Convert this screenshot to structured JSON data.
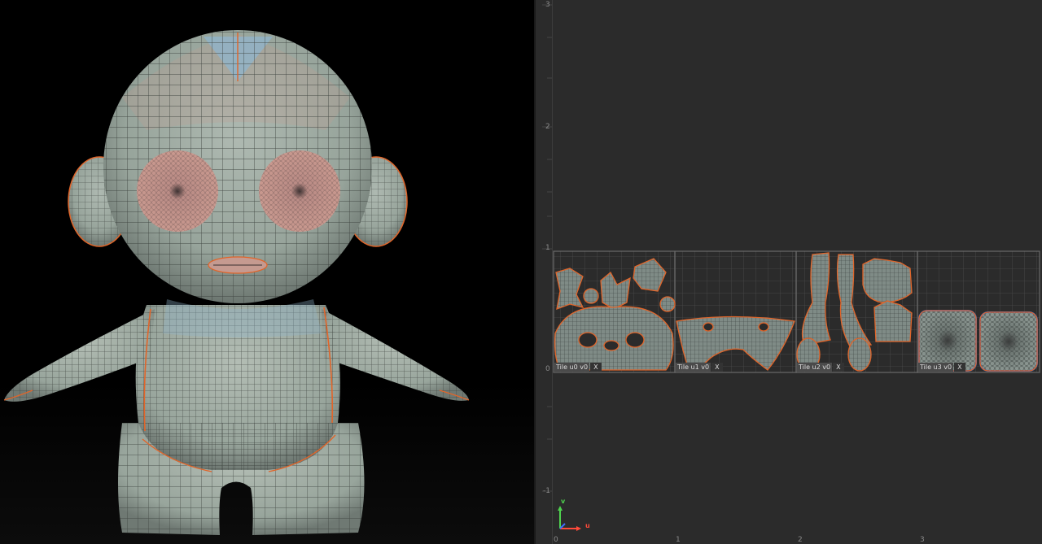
{
  "uv_editor": {
    "v_ticks": [
      "3",
      "2",
      "1",
      "0",
      "-1"
    ],
    "u_ticks": [
      "0",
      "1",
      "2",
      "3"
    ],
    "tiles": [
      {
        "name": "Tile u0 v0",
        "close": "X"
      },
      {
        "name": "Tile u1 v0",
        "close": "X"
      },
      {
        "name": "Tile u2 v0",
        "close": "X"
      },
      {
        "name": "Tile u3 v0",
        "close": "X"
      }
    ],
    "gizmo": {
      "u": "u",
      "v": "v"
    }
  },
  "colors": {
    "uv_border": "#e0652a",
    "uv_fill": "#7f8b86",
    "mesh_body": "#9faca3",
    "mesh_pink": "#c59a90",
    "mesh_blue": "#8fb4cc",
    "gizmo_u": "#ff4a3a",
    "gizmo_v": "#4ed24e"
  }
}
